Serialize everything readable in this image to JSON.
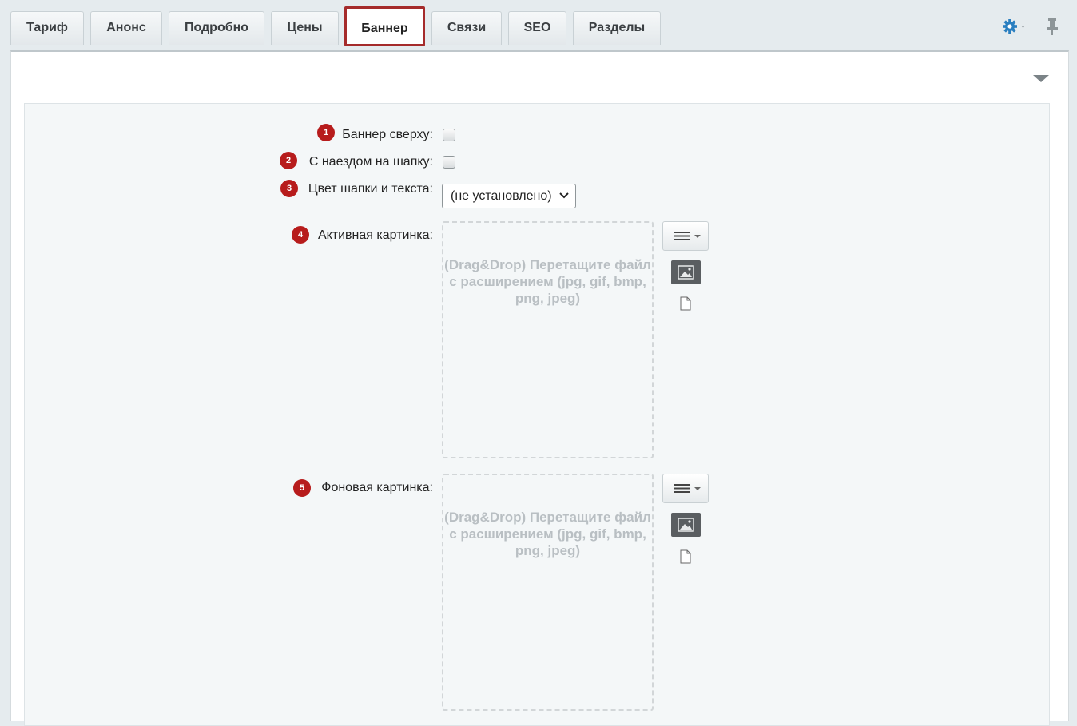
{
  "tabs": [
    {
      "label": "Тариф"
    },
    {
      "label": "Анонс"
    },
    {
      "label": "Подробно"
    },
    {
      "label": "Цены"
    },
    {
      "label": "Баннер",
      "active": true
    },
    {
      "label": "Связи"
    },
    {
      "label": "SEO"
    },
    {
      "label": "Разделы"
    }
  ],
  "toolbar": {
    "settings_icon": "gear-icon",
    "pin_icon": "pin-icon"
  },
  "form": {
    "fields": [
      {
        "badge": "1",
        "label": "Баннер сверху:",
        "type": "checkbox",
        "checked": false
      },
      {
        "badge": "2",
        "label": "С наездом на шапку:",
        "type": "checkbox",
        "checked": false
      },
      {
        "badge": "3",
        "label": "Цвет шапки и текста:",
        "type": "select",
        "value": "(не установлено)"
      },
      {
        "badge": "4",
        "label": "Активная картинка:",
        "type": "file",
        "dropzone_text": "(Drag&Drop) Перетащите файл с расширением (jpg, gif, bmp, png, jpeg)"
      },
      {
        "badge": "5",
        "label": "Фоновая картинка:",
        "type": "file",
        "dropzone_text": "(Drag&Drop) Перетащите файл с расширением (jpg, gif, bmp, png, jpeg)"
      }
    ]
  },
  "colors": {
    "accent": "#a52b2b",
    "badge": "#b71c1c",
    "settings": "#2a7fc0"
  }
}
